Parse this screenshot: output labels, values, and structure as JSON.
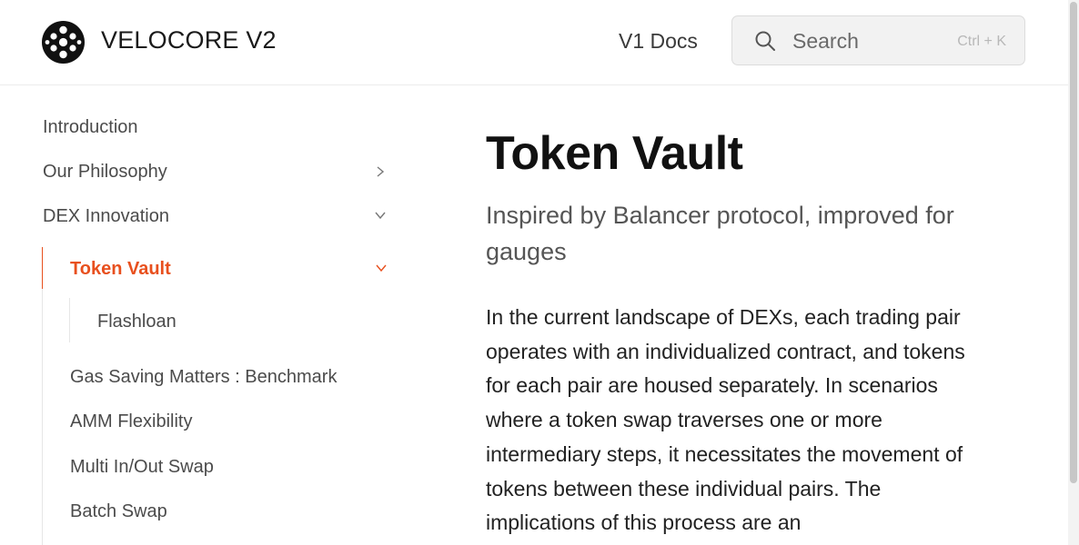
{
  "header": {
    "brand": "VELOCORE V2",
    "v1_docs": "V1 Docs",
    "search_placeholder": "Search",
    "search_shortcut": "Ctrl + K"
  },
  "sidebar": {
    "items": [
      {
        "label": "Introduction"
      },
      {
        "label": "Our Philosophy"
      },
      {
        "label": "DEX Innovation"
      },
      {
        "label": "Token Vault"
      },
      {
        "label": "Flashloan"
      },
      {
        "label": "Gas Saving Matters : Benchmark"
      },
      {
        "label": "AMM Flexibility"
      },
      {
        "label": "Multi In/Out Swap"
      },
      {
        "label": "Batch Swap"
      }
    ]
  },
  "main": {
    "title": "Token Vault",
    "subtitle": "Inspired by Balancer protocol, improved for gauges",
    "paragraph": "In the current landscape of DEXs, each trading pair operates with an individualized contract, and tokens for each pair are housed separately. In scenarios where a token swap traverses one or more intermediary steps, it necessitates the movement of tokens between these individual pairs. The implications of this process are an"
  },
  "colors": {
    "accent": "#e8501e",
    "text": "#1f1f1f",
    "muted": "#555555"
  }
}
